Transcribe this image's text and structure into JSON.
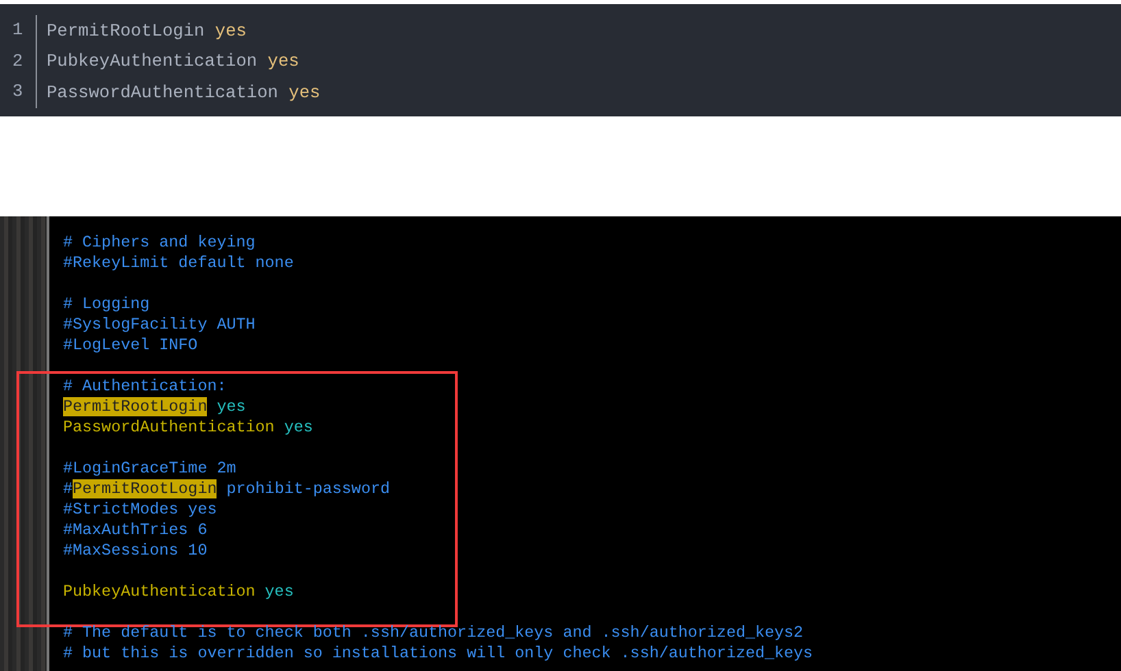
{
  "code_block": {
    "lines": [
      {
        "number": "1",
        "key": "PermitRootLogin",
        "value": "yes"
      },
      {
        "number": "2",
        "key": "PubkeyAuthentication",
        "value": "yes"
      },
      {
        "number": "3",
        "key": "PasswordAuthentication",
        "value": "yes"
      }
    ]
  },
  "terminal": {
    "blocks": [
      {
        "boxed": false,
        "lines": [
          {
            "kind": "text",
            "segments": [
              {
                "kind": "comment",
                "text": "# Ciphers and keying"
              }
            ]
          },
          {
            "kind": "text",
            "segments": [
              {
                "kind": "comment",
                "text": "#RekeyLimit default none"
              }
            ]
          },
          {
            "kind": "blank"
          },
          {
            "kind": "text",
            "segments": [
              {
                "kind": "comment",
                "text": "# Logging"
              }
            ]
          },
          {
            "kind": "text",
            "segments": [
              {
                "kind": "comment",
                "text": "#SyslogFacility AUTH"
              }
            ]
          },
          {
            "kind": "text",
            "segments": [
              {
                "kind": "comment",
                "text": "#LogLevel INFO"
              }
            ]
          },
          {
            "kind": "blank"
          }
        ]
      },
      {
        "boxed": true,
        "lines": [
          {
            "kind": "text",
            "segments": [
              {
                "kind": "comment",
                "text": "# Authentication:"
              }
            ]
          },
          {
            "kind": "text",
            "segments": [
              {
                "kind": "match",
                "text": "PermitRootLogin"
              },
              {
                "kind": "value",
                "text": " yes"
              }
            ]
          },
          {
            "kind": "text",
            "segments": [
              {
                "kind": "key",
                "text": "PasswordAuthentication"
              },
              {
                "kind": "value",
                "text": " yes"
              }
            ]
          },
          {
            "kind": "blank"
          },
          {
            "kind": "text",
            "segments": [
              {
                "kind": "comment",
                "text": "#LoginGraceTime 2m"
              }
            ]
          },
          {
            "kind": "text",
            "segments": [
              {
                "kind": "comment",
                "text": "#"
              },
              {
                "kind": "match",
                "text": "PermitRootLogin"
              },
              {
                "kind": "comment",
                "text": " prohibit-password"
              }
            ]
          },
          {
            "kind": "text",
            "segments": [
              {
                "kind": "comment",
                "text": "#StrictModes yes"
              }
            ]
          },
          {
            "kind": "text",
            "segments": [
              {
                "kind": "comment",
                "text": "#MaxAuthTries 6"
              }
            ]
          },
          {
            "kind": "text",
            "segments": [
              {
                "kind": "comment",
                "text": "#MaxSessions 10"
              }
            ]
          },
          {
            "kind": "blank"
          },
          {
            "kind": "text",
            "segments": [
              {
                "kind": "key",
                "text": "PubkeyAuthentication"
              },
              {
                "kind": "value",
                "text": " yes"
              }
            ]
          },
          {
            "kind": "blank"
          }
        ]
      },
      {
        "boxed": false,
        "lines": [
          {
            "kind": "text",
            "segments": [
              {
                "kind": "comment",
                "text": "# The default is to check both .ssh/authorized_keys and .ssh/authorized_keys2"
              }
            ]
          },
          {
            "kind": "text",
            "segments": [
              {
                "kind": "comment",
                "text": "# but this is overridden so installations will only check .ssh/authorized_keys"
              }
            ]
          }
        ]
      }
    ]
  }
}
